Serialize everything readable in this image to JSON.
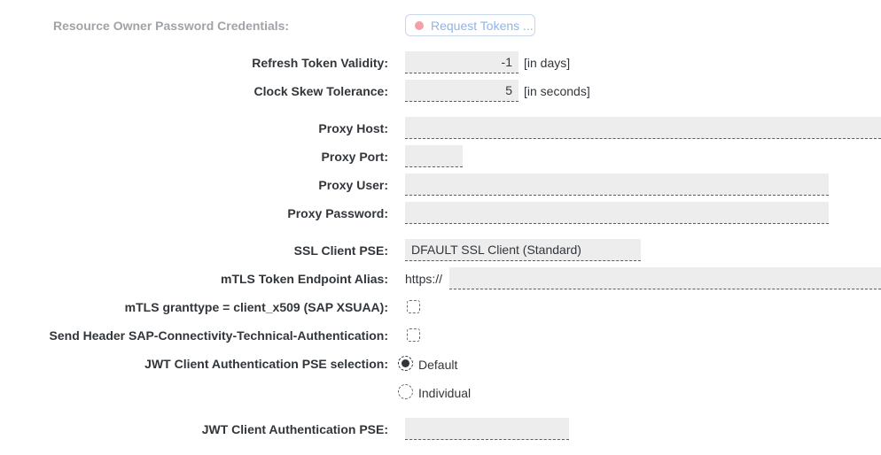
{
  "ropc": {
    "label": "Resource Owner Password Credentials:",
    "button_label": "Request Tokens ..."
  },
  "refresh_token": {
    "label": "Refresh Token Validity:",
    "value": "-1",
    "unit": "[in days]"
  },
  "clock_skew": {
    "label": "Clock Skew Tolerance:",
    "value": "5",
    "unit": "[in seconds]"
  },
  "proxy_host": {
    "label": "Proxy Host:",
    "value": ""
  },
  "proxy_port": {
    "label": "Proxy Port:",
    "value": ""
  },
  "proxy_user": {
    "label": "Proxy User:",
    "value": ""
  },
  "proxy_password": {
    "label": "Proxy Password:",
    "value": ""
  },
  "ssl_client_pse": {
    "label": "SSL Client PSE:",
    "value": "DFAULT SSL Client (Standard)"
  },
  "mtls_alias": {
    "label": "mTLS Token Endpoint Alias:",
    "prefix": "https://",
    "value": ""
  },
  "mtls_granttype": {
    "label": "mTLS granttype = client_x509 (SAP XSUAA):",
    "checked": false
  },
  "send_header": {
    "label": "Send Header SAP-Connectivity-Technical-Authentication:",
    "checked": false
  },
  "jwt_pse_selection": {
    "label": "JWT Client Authentication PSE selection:",
    "options": [
      "Default",
      "Individual"
    ],
    "selected": "Default"
  },
  "jwt_pse": {
    "label": "JWT Client Authentication PSE:",
    "value": ""
  }
}
